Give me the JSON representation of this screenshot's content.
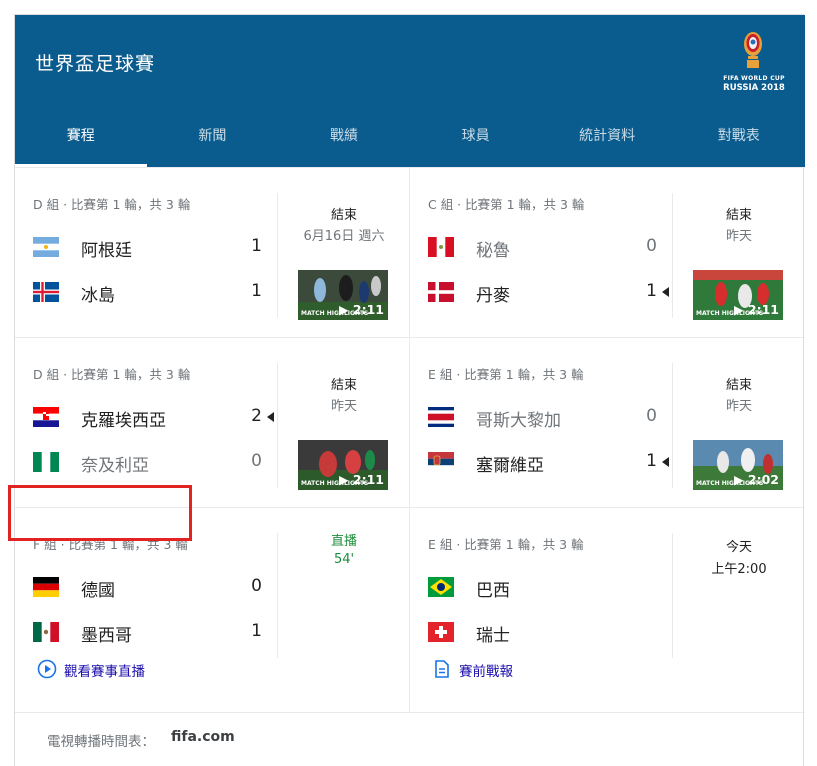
{
  "header": {
    "title": "世界盃足球賽",
    "logo_line1": "FIFA WORLD CUP",
    "logo_line2": "RUSSIA 2018",
    "brand_color": "#0b5c8e"
  },
  "tabs": [
    {
      "label": "賽程",
      "active": true
    },
    {
      "label": "新聞",
      "active": false
    },
    {
      "label": "戰績",
      "active": false
    },
    {
      "label": "球員",
      "active": false
    },
    {
      "label": "統計資料",
      "active": false
    },
    {
      "label": "對戰表",
      "active": false
    }
  ],
  "matches": [
    {
      "group": "D 組 · 比賽第 1 輪，共 3 輪",
      "home": {
        "name": "阿根廷",
        "score": "1",
        "flag": "argentina-flag"
      },
      "away": {
        "name": "冰島",
        "score": "1",
        "flag": "iceland-flag"
      },
      "status": "結束",
      "status_sub": "6月16日 週六",
      "video": {
        "label": "MATCH HIGHLIGHTS",
        "duration": "2:11"
      }
    },
    {
      "group": "C 組 · 比賽第 1 輪，共 3 輪",
      "home": {
        "name": "秘魯",
        "score": "0",
        "flag": "peru-flag"
      },
      "away": {
        "name": "丹麥",
        "score": "1",
        "flag": "denmark-flag"
      },
      "status": "結束",
      "status_sub": "昨天",
      "video": {
        "label": "MATCH HIGHLIGHTS",
        "duration": "2:11"
      }
    },
    {
      "group": "D 組 · 比賽第 1 輪，共 3 輪",
      "home": {
        "name": "克羅埃西亞",
        "score": "2",
        "flag": "croatia-flag"
      },
      "away": {
        "name": "奈及利亞",
        "score": "0",
        "flag": "nigeria-flag"
      },
      "status": "結束",
      "status_sub": "昨天",
      "video": {
        "label": "MATCH HIGHLIGHTS",
        "duration": "2:11"
      }
    },
    {
      "group": "E 組 · 比賽第 1 輪，共 3 輪",
      "home": {
        "name": "哥斯大黎加",
        "score": "0",
        "flag": "costa-rica-flag"
      },
      "away": {
        "name": "塞爾維亞",
        "score": "1",
        "flag": "serbia-flag"
      },
      "status": "結束",
      "status_sub": "昨天",
      "video": {
        "label": "MATCH HIGHLIGHTS",
        "duration": "2:02"
      }
    },
    {
      "group": "F 組 · 比賽第 1 輪，共 3 輪",
      "home": {
        "name": "德國",
        "score": "0",
        "flag": "germany-flag"
      },
      "away": {
        "name": "墨西哥",
        "score": "1",
        "flag": "mexico-flag"
      },
      "status": "直播",
      "status_sub": "54'",
      "action": {
        "label": "觀看賽事直播",
        "icon": "play-circle-icon"
      }
    },
    {
      "group": "E 組 · 比賽第 1 輪，共 3 輪",
      "home": {
        "name": "巴西",
        "flag": "brazil-flag"
      },
      "away": {
        "name": "瑞士",
        "flag": "switzerland-flag"
      },
      "status": "今天",
      "status_sub": "上午2:00",
      "action": {
        "label": "賽前戰報",
        "icon": "document-icon"
      }
    }
  ],
  "footer": {
    "text": "電視轉播時間表：",
    "link": "fifa.com"
  },
  "colors": {
    "live_green": "#1e8e3e",
    "link_blue": "#1a0dab",
    "highlight_red": "#e32322"
  }
}
